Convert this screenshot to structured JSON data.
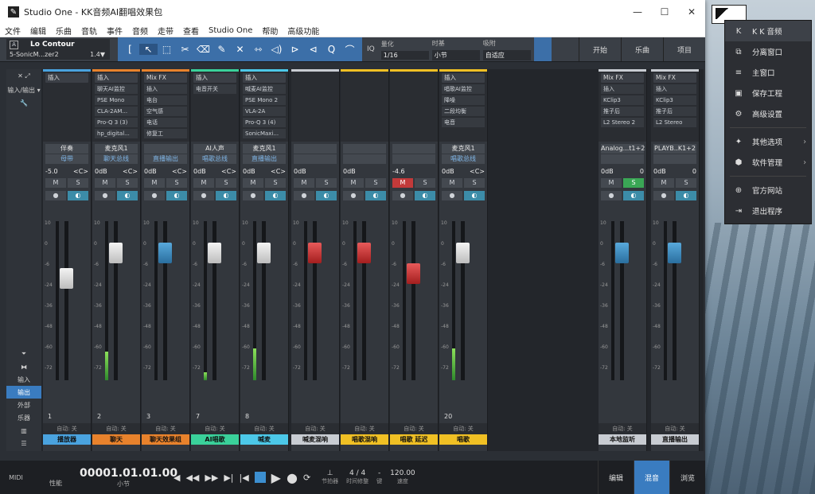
{
  "window": {
    "title": "Studio One - KK音频AI翻唱效果包",
    "controls": [
      "—",
      "☐",
      "✕"
    ]
  },
  "menu": [
    "文件",
    "编辑",
    "乐曲",
    "音轨",
    "事件",
    "音频",
    "走带",
    "查看",
    "Studio One",
    "帮助",
    "高级功能"
  ],
  "toolbar": {
    "preset_name": "Lo Contour",
    "preset_sub": "5-SonicM...zer2",
    "preset_ver": "1.4▼",
    "quantize_label": "量化",
    "quantize": "1/16",
    "timebase_label": "时基",
    "timebase": "小节",
    "snap_label": "吸附",
    "snap": "自适应",
    "right": [
      "开始",
      "乐曲",
      "项目"
    ]
  },
  "left_panel": [
    "输入",
    "输出",
    "外部",
    "乐器"
  ],
  "channels": [
    {
      "ins_head": "插入",
      "inserts": [],
      "io1": "伴奏",
      "io2": "母带",
      "pan": "-5.0",
      "pan2": "<C>",
      "ms": [
        "M",
        "S"
      ],
      "num": "1",
      "auto": "自动: 关",
      "name": "播放器",
      "color": "#4aa3df",
      "cap": "white",
      "cap_pos": 0.36,
      "meter": 0.0
    },
    {
      "ins_head": "插入",
      "inserts": [
        "聊天AI监控",
        "PSE Mono",
        "CLA-2AM...",
        "Pro-Q 3 (3)",
        "hp_digital..."
      ],
      "io1": "麦克风1",
      "io2": "聊天总线",
      "pan": "0dB",
      "pan2": "<C>",
      "ms": [
        "M",
        "S"
      ],
      "num": "2",
      "auto": "自动: 关",
      "name": "聊天",
      "color": "#e8822c",
      "cap": "white",
      "cap_pos": 0.2,
      "meter": 0.18
    },
    {
      "ins_head": "Mix FX",
      "inserts": [
        "插入",
        "电台",
        "空气感",
        "电话",
        "修复工"
      ],
      "io1": "",
      "io2": "直播输出",
      "pan": "0dB",
      "pan2": "<C>",
      "ms": [
        "M",
        "S"
      ],
      "num": "3",
      "auto": "自动: 关",
      "name": "聊天效果组",
      "color": "#e8822c",
      "cap": "blue",
      "cap_pos": 0.2,
      "meter": 0.0
    },
    {
      "ins_head": "插入",
      "inserts": [
        "电音开关"
      ],
      "io1": "AI人声",
      "io2": "唱歌总线",
      "pan": "0dB",
      "pan2": "<C>",
      "ms": [
        "M",
        "S"
      ],
      "num": "7",
      "auto": "自动: 关",
      "name": "AI唱歌",
      "color": "#3ad19a",
      "cap": "white",
      "cap_pos": 0.2,
      "meter": 0.05
    },
    {
      "ins_head": "插入",
      "inserts": [
        "喊麦AI监控",
        "PSE Mono 2",
        "VLA-2A",
        "Pro-Q 3 (4)",
        "SonicMaxi..."
      ],
      "io1": "麦克风1",
      "io2": "直播输出",
      "pan": "0dB",
      "pan2": "<C>",
      "ms": [
        "M",
        "S"
      ],
      "num": "8",
      "auto": "自动: 关",
      "name": "喊麦",
      "color": "#4cc8e8",
      "cap": "white",
      "cap_pos": 0.2,
      "meter": 0.2
    },
    {
      "ins_head": "",
      "inserts": [],
      "io1": "",
      "io2": "",
      "pan": "0dB",
      "pan2": "",
      "ms": [
        "M",
        "S"
      ],
      "num": "",
      "auto": "自动: 关",
      "name": "喊麦混响",
      "color": "#c8ccd2",
      "cap": "red",
      "cap_pos": 0.2,
      "meter": 0.0
    },
    {
      "ins_head": "",
      "inserts": [],
      "io1": "",
      "io2": "",
      "pan": "0dB",
      "pan2": "",
      "ms": [
        "M",
        "S"
      ],
      "num": "",
      "auto": "自动: 关",
      "name": "唱歌混响",
      "color": "#f0c024",
      "cap": "red",
      "cap_pos": 0.2,
      "meter": 0.0
    },
    {
      "ins_head": "",
      "inserts": [],
      "io1": "",
      "io2": "",
      "pan": "-4.6",
      "pan2": "",
      "ms": [
        "M",
        "S"
      ],
      "num": "",
      "auto": "自动: 关",
      "name": "唱歌 延迟",
      "color": "#f0c024",
      "cap": "red",
      "cap_pos": 0.33,
      "meter": 0.0
    },
    {
      "ins_head": "插入",
      "inserts": [
        "唱歌AI监控",
        "降噪",
        "二段均衡",
        "电音"
      ],
      "io1": "麦克风1",
      "io2": "唱歌总线",
      "pan": "0dB",
      "pan2": "<C>",
      "ms": [
        "M",
        "S"
      ],
      "num": "20",
      "auto": "自动: 关",
      "name": "唱歌",
      "color": "#f0c024",
      "cap": "white",
      "cap_pos": 0.2,
      "meter": 0.2
    },
    {
      "ins_head": "Mix FX",
      "inserts": [
        "插入",
        "KClip3",
        "推子后",
        "L2 Stereo 2"
      ],
      "io1": "Analog...t1+2",
      "io2": "",
      "pan": "0dB",
      "pan2": "0",
      "ms": [
        "M",
        "S"
      ],
      "num": "",
      "auto": "自动: 关",
      "name": "本地监听",
      "color": "#c8ccd2",
      "cap": "blue",
      "cap_pos": 0.2,
      "meter": 0.0
    },
    {
      "ins_head": "Mix FX",
      "inserts": [
        "插入",
        "KClip3",
        "推子后",
        "L2 Stereo"
      ],
      "io1": "PLAYB..K1+2",
      "io2": "",
      "pan": "0dB",
      "pan2": "0",
      "ms": [
        "M",
        "S"
      ],
      "num": "",
      "auto": "自动: 关",
      "name": "直播输出",
      "color": "#c8ccd2",
      "cap": "blue",
      "cap_pos": 0.2,
      "meter": 0.0
    }
  ],
  "transport": {
    "midi": "MIDI",
    "perf": "性能",
    "time": "00001.01.01.00",
    "time_unit": "小节",
    "meter": "4 / 4",
    "meter_label": "时间修整",
    "key": "-",
    "key_label": "键",
    "tempo": "120.00",
    "tempo_label": "速度",
    "metronome_label": "节拍器",
    "views": [
      "编辑",
      "混音",
      "浏览"
    ]
  },
  "popup": {
    "items": [
      {
        "icon": "K",
        "label": "K K 音频"
      },
      {
        "icon": "⧉",
        "label": "分离窗口"
      },
      {
        "icon": "≡",
        "label": "主窗口"
      },
      {
        "icon": "▣",
        "label": "保存工程"
      },
      {
        "icon": "⚙",
        "label": "高级设置"
      },
      {
        "icon": "✦",
        "label": "其他选项",
        "arr": "›"
      },
      {
        "icon": "⬢",
        "label": "软件管理",
        "arr": "›"
      },
      {
        "icon": "⊕",
        "label": "官方网站"
      },
      {
        "icon": "⇥",
        "label": "退出程序"
      }
    ]
  }
}
